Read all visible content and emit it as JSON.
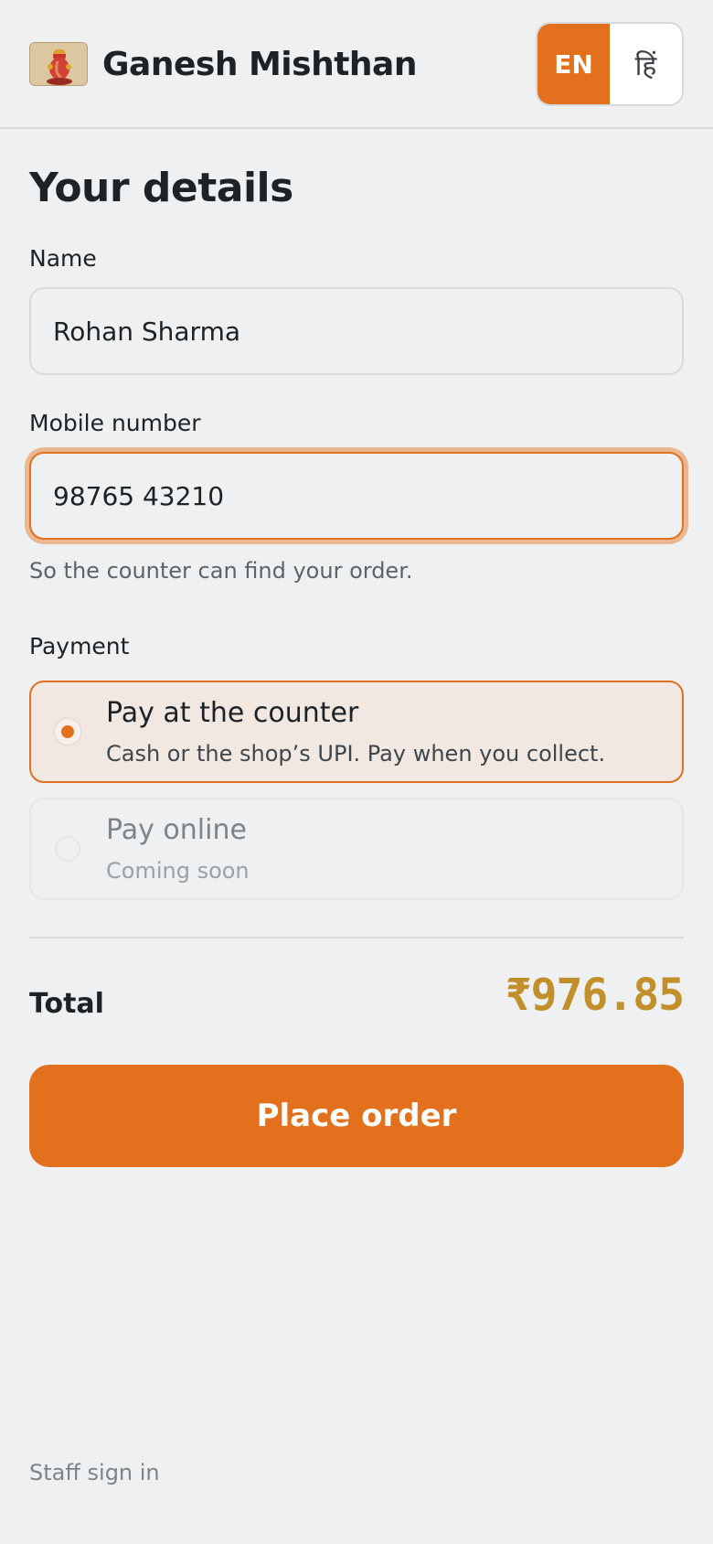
{
  "header": {
    "logo_icon": "ganesha-icon",
    "brand": "Ganesh Mishthan",
    "lang_options": [
      "EN",
      "हिं"
    ],
    "lang_active": "EN"
  },
  "form": {
    "title": "Your details",
    "name_label": "Name",
    "name_value": "Rohan Sharma",
    "mobile_label": "Mobile number",
    "mobile_value": "98765 43210",
    "mobile_hint": "So the counter can find your order.",
    "payment_label": "Payment",
    "payment_options": [
      {
        "title": "Pay at the counter",
        "subtitle": "Cash or the shop’s UPI. Pay when you collect.",
        "selected": true,
        "disabled": false
      },
      {
        "title": "Pay online",
        "subtitle": "Coming soon",
        "selected": false,
        "disabled": true
      }
    ]
  },
  "summary": {
    "total_label": "Total",
    "total_value": "₹976.85"
  },
  "actions": {
    "place_order": "Place order",
    "staff_sign_in": "Staff sign in"
  },
  "colors": {
    "accent": "#e2701c",
    "total": "#c1902a",
    "background": "#eef0f2"
  }
}
